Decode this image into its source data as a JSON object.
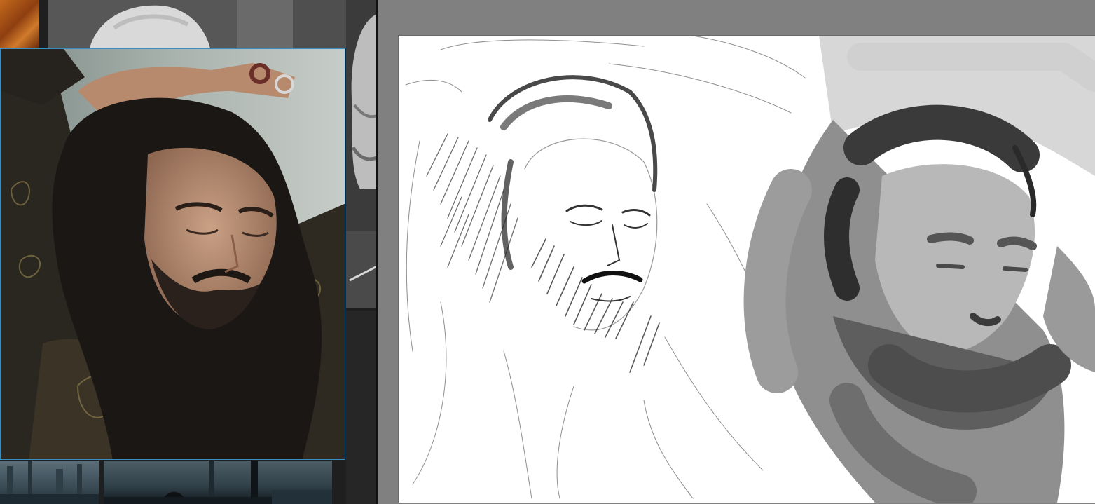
{
  "window": {
    "reference_panel_name": "",
    "canvas_name": ""
  },
  "colors": {
    "workspace_bg": "#808080",
    "canvas_bg": "#ffffff",
    "panel_bg": "#1f1f1f",
    "selection_border": "#3a8fc2"
  },
  "reference_board": {
    "images": [
      {
        "id": "thumb-paint",
        "icon": "paint-texture-image"
      },
      {
        "id": "thumb-sculpt",
        "icon": "sculpture-head-image"
      },
      {
        "id": "selected-photo",
        "icon": "portrait-photo-image",
        "selected": true
      },
      {
        "id": "thumb-sculpt-side",
        "icon": "sculpture-face-image"
      },
      {
        "id": "thumb-city-1",
        "icon": "street-photo-image"
      },
      {
        "id": "thumb-city-2",
        "icon": "street-photo-image"
      }
    ]
  },
  "canvas": {
    "sketches": [
      {
        "name": "pencil-sketch",
        "style": "graphite"
      },
      {
        "name": "grayscale-study",
        "style": "value-blocking"
      }
    ]
  }
}
